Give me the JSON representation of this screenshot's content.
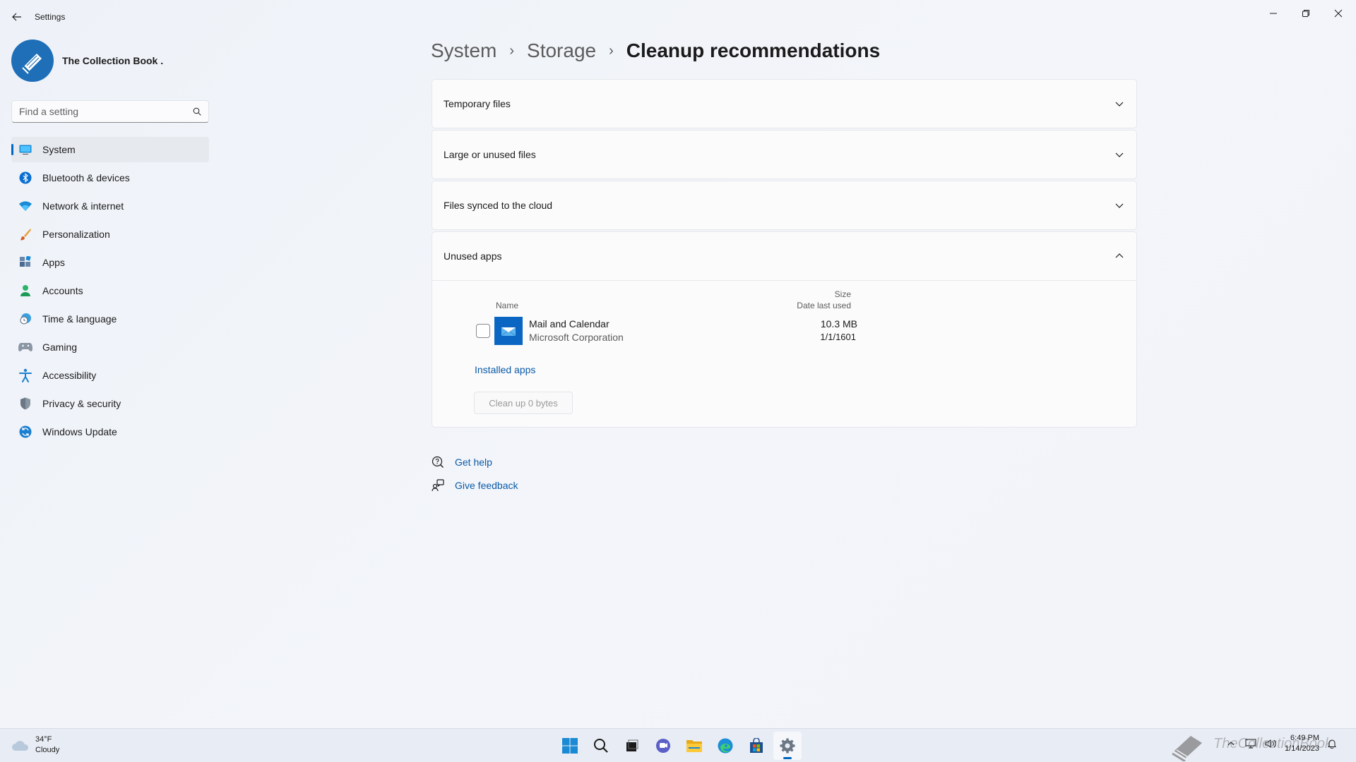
{
  "window": {
    "title": "Settings"
  },
  "profile": {
    "name": "The Collection Book ."
  },
  "search": {
    "placeholder": "Find a setting"
  },
  "nav": {
    "items": [
      {
        "label": "System",
        "icon": "monitor-icon",
        "active": true
      },
      {
        "label": "Bluetooth & devices",
        "icon": "bluetooth-icon"
      },
      {
        "label": "Network & internet",
        "icon": "wifi-icon"
      },
      {
        "label": "Personalization",
        "icon": "brush-icon"
      },
      {
        "label": "Apps",
        "icon": "apps-icon"
      },
      {
        "label": "Accounts",
        "icon": "person-icon"
      },
      {
        "label": "Time & language",
        "icon": "clock-globe-icon"
      },
      {
        "label": "Gaming",
        "icon": "gamepad-icon"
      },
      {
        "label": "Accessibility",
        "icon": "accessibility-icon"
      },
      {
        "label": "Privacy & security",
        "icon": "shield-icon"
      },
      {
        "label": "Windows Update",
        "icon": "update-icon"
      }
    ]
  },
  "breadcrumb": {
    "parent1": "System",
    "parent2": "Storage",
    "current": "Cleanup recommendations",
    "separator": "›"
  },
  "sections": {
    "temp": "Temporary files",
    "large": "Large or unused files",
    "cloud": "Files synced to the cloud",
    "unused": "Unused apps"
  },
  "unused_apps": {
    "col_name": "Name",
    "col_size": "Size",
    "col_date": "Date last used",
    "apps": [
      {
        "name": "Mail and Calendar",
        "publisher": "Microsoft Corporation",
        "size": "10.3 MB",
        "date": "1/1/1601",
        "checked": false
      }
    ],
    "installed_link": "Installed apps",
    "cleanup_button": "Clean up 0 bytes"
  },
  "help": {
    "get_help": "Get help",
    "feedback": "Give feedback"
  },
  "taskbar": {
    "weather_temp": "34°F",
    "weather_desc": "Cloudy",
    "time": "6:49 PM",
    "date": "1/14/2023",
    "watermark": "TheCollectionBook"
  },
  "colors": {
    "accent": "#0067c0",
    "link": "#0a5aa6",
    "background": "#f1f4f9"
  }
}
